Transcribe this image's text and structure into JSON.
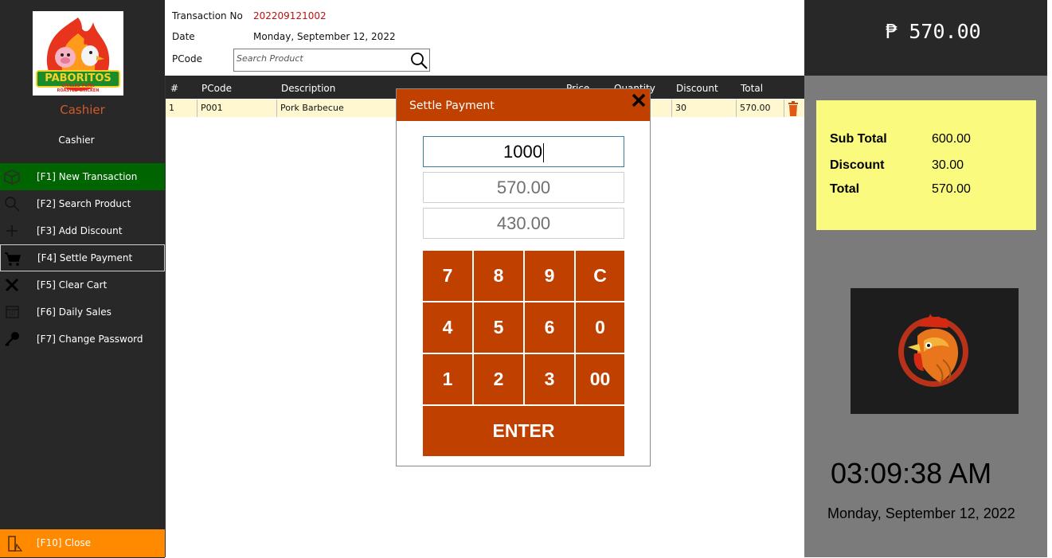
{
  "sidebar": {
    "logo": {
      "text": "PABORITOS",
      "subtext1": "GRILLED PORK",
      "subtext2": "ROASTED CHICKEN"
    },
    "role": "Cashier",
    "user": "Cashier",
    "menu": [
      {
        "label": "[F1] New Transaction",
        "icon": "box-icon"
      },
      {
        "label": "[F2] Search Product",
        "icon": "search-icon"
      },
      {
        "label": "[F3] Add Discount",
        "icon": "plus-icon"
      },
      {
        "label": "[F4] Settle Payment",
        "icon": "cart-icon"
      },
      {
        "label": "[F5] Clear Cart",
        "icon": "x-icon"
      },
      {
        "label": "[F6] Daily Sales",
        "icon": "calendar-icon"
      },
      {
        "label": "[F7] Change Password",
        "icon": "key-icon"
      }
    ],
    "close_label": "[F10] Close",
    "colors": {
      "active": "#006400",
      "close": "#ff8a00",
      "role": "#d05a2a"
    }
  },
  "header": {
    "transaction_label": "Transaction No",
    "transaction_no": "202209121002",
    "date_label": "Date",
    "date": "Monday, September 12, 2022",
    "pcode_label": "PCode",
    "search_placeholder": "Search Product"
  },
  "table": {
    "columns": [
      "#",
      "PCode",
      "Description",
      "Price",
      "Quantity",
      "Discount",
      "Total"
    ],
    "rows": [
      {
        "num": "1",
        "pcode": "P001",
        "description": "Pork Barbecue",
        "price": "",
        "quantity": "",
        "discount": "30",
        "total": "570.00"
      }
    ]
  },
  "right_panel": {
    "amount": "₱ 570.00",
    "summary": {
      "subtotal_label": "Sub Total",
      "subtotal": "600.00",
      "discount_label": "Discount",
      "discount": "30.00",
      "total_label": "Total",
      "total": "570.00"
    },
    "time": "03:09:38 AM",
    "date": "Monday, September 12, 2022"
  },
  "dialog": {
    "title": "Settle Payment",
    "cash": "1000",
    "sale": "570.00",
    "change": "430.00",
    "keys": [
      "7",
      "8",
      "9",
      "C",
      "4",
      "5",
      "6",
      "0",
      "1",
      "2",
      "3",
      "00"
    ],
    "enter": "ENTER",
    "accent": "#c04000"
  }
}
